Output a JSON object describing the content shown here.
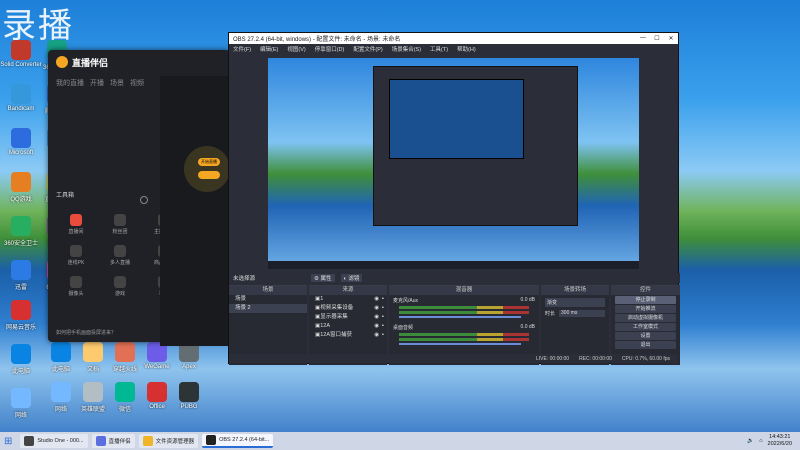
{
  "watermark": "录播",
  "desktop": {
    "icons": [
      {
        "label": "Solid Converter",
        "color": "#c0392b"
      },
      {
        "label": "Bandicam",
        "color": "#3498db"
      },
      {
        "label": "Microsoft",
        "color": "#2d6cdf"
      },
      {
        "label": "QQ游戏",
        "color": "#e67e22"
      },
      {
        "label": "360安全卫士",
        "color": "#27ae60"
      },
      {
        "label": "迅雷",
        "color": "#2c7be5"
      },
      {
        "label": "360浏览器",
        "color": "#16a085"
      },
      {
        "label": "腾讯会议",
        "color": "#3867d6"
      },
      {
        "label": "酷狗",
        "color": "#3b8de0"
      },
      {
        "label": "直播伴侣",
        "color": "#f1c40f"
      },
      {
        "label": "爱奇艺",
        "color": "#8e44ad"
      },
      {
        "label": "QQ音乐",
        "color": "#e84393"
      },
      {
        "label": "网易云音乐",
        "color": "#d63031"
      },
      {
        "label": "此电脑",
        "color": "#0984e3"
      },
      {
        "label": "网络",
        "color": "#74b9ff"
      }
    ],
    "bottom_icons": [
      {
        "label": "此电脑",
        "color": "#0984e3"
      },
      {
        "label": "文档",
        "color": "#fdcb6e"
      },
      {
        "label": "穿越火线",
        "color": "#e17055"
      },
      {
        "label": "WeGame",
        "color": "#6c5ce7"
      },
      {
        "label": "Apex",
        "color": "#636e72"
      },
      {
        "label": "网络",
        "color": "#74b9ff"
      },
      {
        "label": "英雄联盟",
        "color": "#b2bec3"
      },
      {
        "label": "微信",
        "color": "#00b894"
      },
      {
        "label": "Office",
        "color": "#d63031"
      },
      {
        "label": "PUBG",
        "color": "#2d3436"
      }
    ]
  },
  "live_companion": {
    "title": "直播伴侣",
    "tabs": [
      "我的直播",
      "开播",
      "场景",
      "视频"
    ],
    "tools_label": "工具箱",
    "tools": [
      "直播间",
      "粉丝团",
      "主播任务",
      "连线PK",
      "多人直播",
      "商品橱窗",
      "摄像头",
      "游戏",
      "福袋"
    ],
    "notice": "如何把手机画面投屏进来？",
    "start_btn": "开始直播"
  },
  "obs": {
    "title": "OBS 27.2.4 (64-bit, windows) - 配置文件: 未命名 - 场景: 未命名",
    "menu": [
      "文件(F)",
      "编辑(E)",
      "视图(V)",
      "停靠窗口(D)",
      "配置文件(P)",
      "场景集合(S)",
      "工具(T)",
      "帮助(H)"
    ],
    "status_source": "未选择源",
    "props_btn": "属性",
    "filters_btn": "滤镜",
    "docks": {
      "scenes": {
        "title": "场景",
        "items": [
          "场景",
          "场景 2"
        ]
      },
      "sources": {
        "title": "来源",
        "items": [
          "1",
          "视频采集设备",
          "显示器采集",
          "12A",
          "12A窗口捕获"
        ]
      },
      "mixer": {
        "title": "混音器",
        "tracks": [
          {
            "name": "麦克风/Aux",
            "db": "0.0 dB"
          },
          {
            "name": "桌面音频",
            "db": "0.0 dB"
          }
        ]
      },
      "transitions": {
        "title": "场景转场",
        "type": "渐变",
        "duration_label": "时长",
        "duration": "300 ms"
      },
      "controls": {
        "title": "控件",
        "buttons": [
          "停止录制",
          "开始推流",
          "启动虚拟摄像机",
          "工作室模式",
          "设置",
          "退出"
        ]
      }
    },
    "statusbar": {
      "live": "LIVE: 00:00:00",
      "rec": "REC: 00:00:00",
      "cpu": "CPU: 0.7%, 60.00 fps"
    }
  },
  "taskbar": {
    "items": [
      {
        "label": "Studio One - 000...",
        "color": "#444"
      },
      {
        "label": "直播伴侣",
        "color": "#5b6ee1"
      },
      {
        "label": "文件资源管理器",
        "color": "#f0b429"
      },
      {
        "label": "OBS 27.2.4 (64-bit...",
        "color": "#222"
      }
    ],
    "time": "14:43:21",
    "date": "2022/6/20"
  }
}
